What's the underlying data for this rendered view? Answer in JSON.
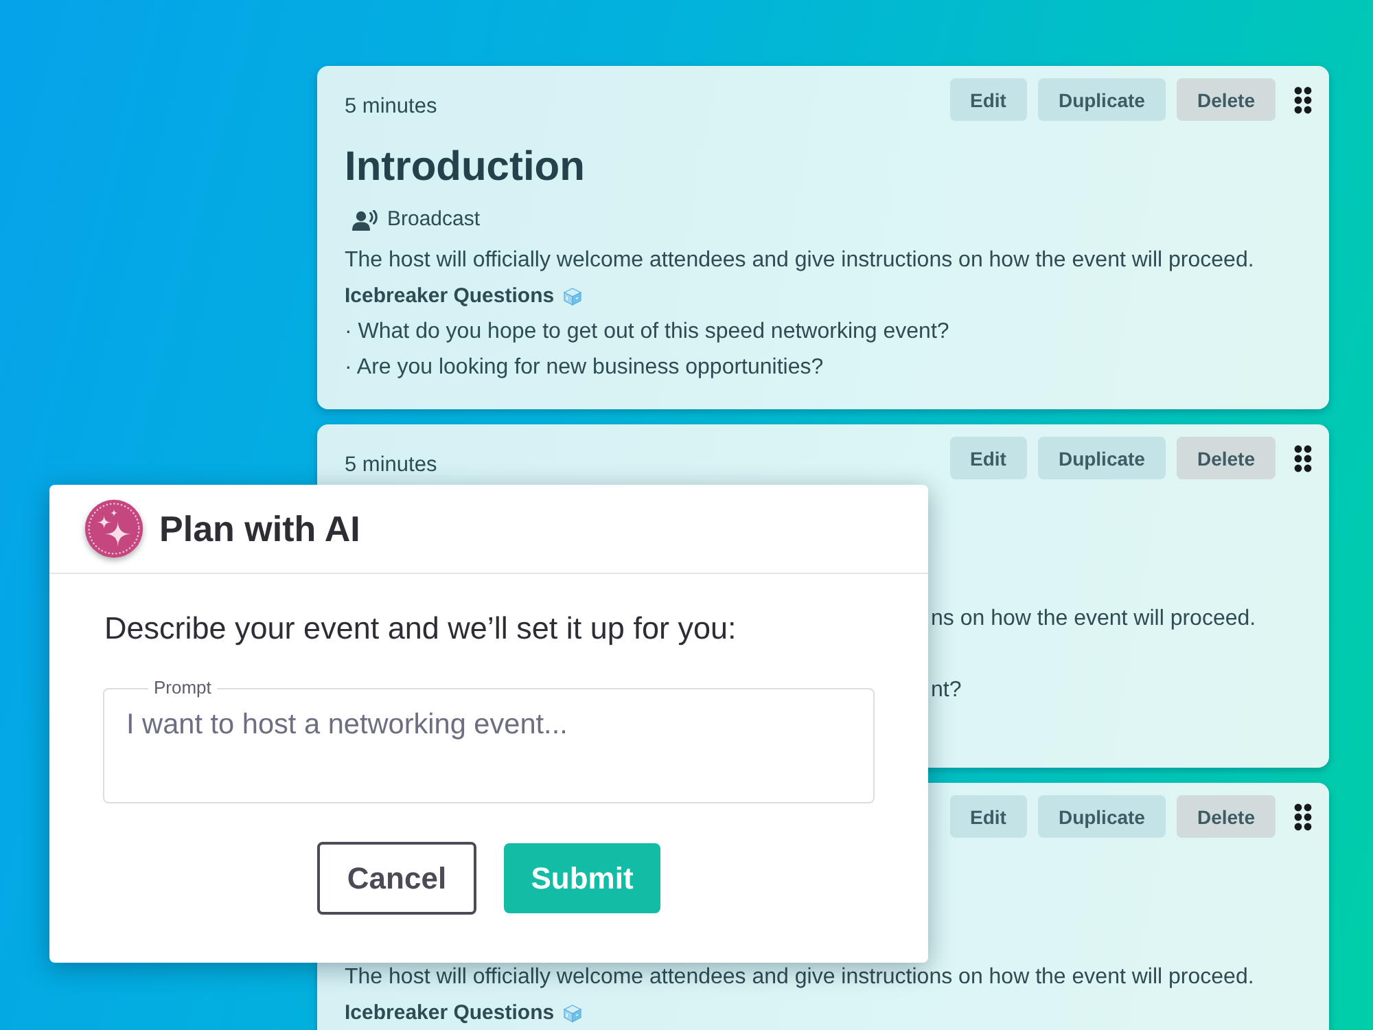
{
  "cards": [
    {
      "time": "5 minutes",
      "title": "Introduction",
      "format": "Broadcast",
      "description": "The host will officially welcome attendees and give instructions on how the event will proceed.",
      "section": "Icebreaker Questions",
      "questions": [
        "· What do you hope to get out of this speed networking event?",
        "· Are you looking for new business opportunities?"
      ],
      "actions": [
        {
          "label": "Edit",
          "kind": "edit"
        },
        {
          "label": "Duplicate",
          "kind": "duplicate"
        },
        {
          "label": "Delete",
          "kind": "delete"
        }
      ]
    },
    {
      "time": "5 minutes",
      "description": "ns on how the event will proceed.",
      "questions": [
        "nt?"
      ],
      "actions": [
        {
          "label": "Edit",
          "kind": "edit"
        },
        {
          "label": "Duplicate",
          "kind": "duplicate"
        },
        {
          "label": "Delete",
          "kind": "delete"
        }
      ]
    },
    {
      "description": "The host will officially welcome attendees and give instructions on how the event will proceed.",
      "section": "Icebreaker Questions",
      "actions": [
        {
          "label": "Edit",
          "kind": "edit"
        },
        {
          "label": "Duplicate",
          "kind": "duplicate"
        },
        {
          "label": "Delete",
          "kind": "delete"
        }
      ]
    }
  ],
  "dialog": {
    "title": "Plan with AI",
    "instruction": "Describe your event and we’ll set it up for you:",
    "field": {
      "label": "Prompt",
      "placeholder": "I want to host a networking event..."
    },
    "buttons": [
      {
        "label": "Cancel",
        "kind": "cancel"
      },
      {
        "label": "Submit",
        "kind": "submit"
      }
    ]
  }
}
